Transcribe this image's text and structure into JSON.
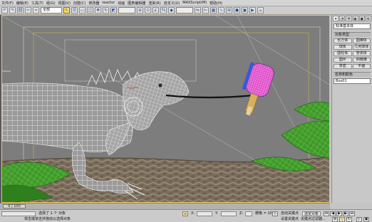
{
  "menubar": {
    "items": [
      "文件(F)",
      "编辑(E)",
      "工具(T)",
      "组(G)",
      "视图(V)",
      "创建(C)",
      "修改器",
      "reactor",
      "动画",
      "图表编辑器",
      "渲染(R)",
      "自定义(U)",
      "MAXScript(M)",
      "帮助(H)"
    ]
  },
  "toolbar": {
    "selection_filter": "全部",
    "buttons": [
      {
        "name": "undo-icon",
        "glyph": "↶"
      },
      {
        "name": "redo-icon",
        "glyph": "↷"
      },
      {
        "name": "link-icon",
        "glyph": "⛓"
      },
      {
        "name": "unlink-icon",
        "glyph": "✂"
      },
      {
        "name": "bind-space-warp-icon",
        "glyph": "≈"
      },
      {
        "name": "select-icon",
        "glyph": "↖",
        "active": true
      },
      {
        "name": "select-by-name-icon",
        "glyph": "☰"
      },
      {
        "name": "rect-region-icon",
        "glyph": "▭"
      },
      {
        "name": "window-crossing-icon",
        "glyph": "◫"
      },
      {
        "name": "move-icon",
        "glyph": "✥"
      },
      {
        "name": "rotate-icon",
        "glyph": "↻"
      },
      {
        "name": "scale-icon",
        "glyph": "◩"
      },
      {
        "name": "ref-coord-icon",
        "glyph": "▤"
      },
      {
        "name": "pivot-icon",
        "glyph": "⊕"
      },
      {
        "name": "snap-icon",
        "glyph": "⊙"
      },
      {
        "name": "angle-snap-icon",
        "glyph": "∠"
      },
      {
        "name": "percent-snap-icon",
        "glyph": "%"
      },
      {
        "name": "spinner-snap-icon",
        "glyph": "◆"
      },
      {
        "name": "mirror-icon",
        "glyph": "⇋"
      },
      {
        "name": "align-icon",
        "glyph": "⊨"
      },
      {
        "name": "layer-icon",
        "glyph": "▦"
      },
      {
        "name": "curve-editor-icon",
        "glyph": "∿"
      },
      {
        "name": "schematic-icon",
        "glyph": "⊞"
      },
      {
        "name": "material-editor-icon",
        "glyph": "●"
      },
      {
        "name": "render-setup-icon",
        "glyph": "▣"
      },
      {
        "name": "render-icon",
        "glyph": "▶"
      },
      {
        "name": "quick-render-icon",
        "glyph": "☕"
      }
    ]
  },
  "viewport": {
    "label": ""
  },
  "command_panel": {
    "tabs": [
      "✦",
      "◔",
      "⚒",
      "◉",
      "▣",
      "⚙"
    ],
    "dropdown": "标准基本体",
    "section1": "对象类型",
    "buttons": [
      [
        "长方体",
        "圆锥体"
      ],
      [
        "球体",
        "几何球体"
      ],
      [
        "圆柱体",
        "管状体"
      ],
      [
        "圆环",
        "四棱锥"
      ],
      [
        "茶壶",
        "平面"
      ]
    ],
    "section2": "名称和颜色",
    "name_value": "Box01"
  },
  "timebar": {
    "slider": "0 / 100"
  },
  "statusbar": {
    "selection": "选择了 1 个 对象",
    "prompt": "单击或单击并拖动以选择对象",
    "x_label": "X:",
    "y_label": "Y:",
    "z_label": "Z:",
    "grid": "栅格 = 10.0",
    "auto_key": "自动关键点",
    "set_key": "设置关键点",
    "selected_object": "选定对象",
    "key_filters": "关键点过滤器..."
  }
}
